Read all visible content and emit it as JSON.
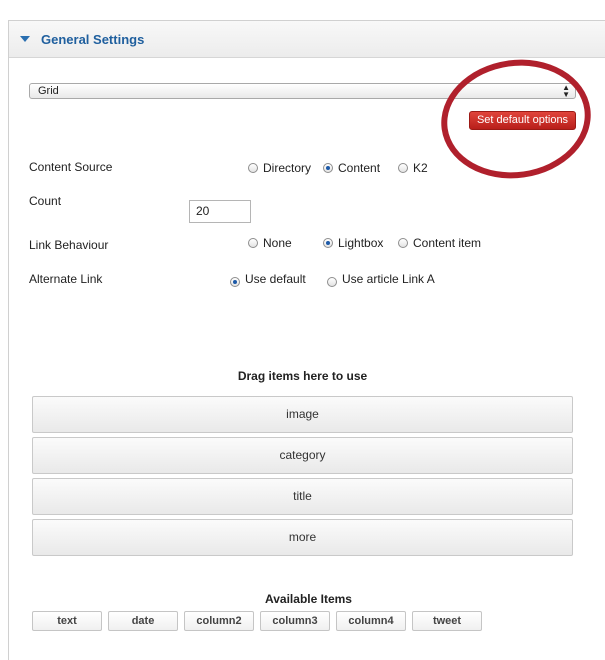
{
  "panel": {
    "title": "General Settings"
  },
  "layout_select": {
    "value": "Grid",
    "arrows": "▲\n▼"
  },
  "default_button": {
    "label": "Set default options"
  },
  "content_source": {
    "label": "Content Source",
    "options": [
      "Directory",
      "Content",
      "K2"
    ],
    "selected": "Content"
  },
  "count": {
    "label": "Count",
    "value": "20"
  },
  "link_behaviour": {
    "label": "Link Behaviour",
    "options": [
      "None",
      "Lightbox",
      "Content item"
    ],
    "selected": "Lightbox"
  },
  "alternate_link": {
    "label": "Alternate Link",
    "options": [
      "Use default",
      "Use article Link A"
    ],
    "selected": "Use default"
  },
  "drop_zone": {
    "title": "Drag items here to use",
    "items": [
      "image",
      "category",
      "title",
      "more"
    ]
  },
  "available": {
    "title": "Available Items",
    "items": [
      "text",
      "date",
      "column2",
      "column3",
      "column4",
      "tweet"
    ]
  },
  "colors": {
    "accent": "#1f5f9e",
    "button_red": "#c8281f",
    "ring": "#b0202c"
  }
}
